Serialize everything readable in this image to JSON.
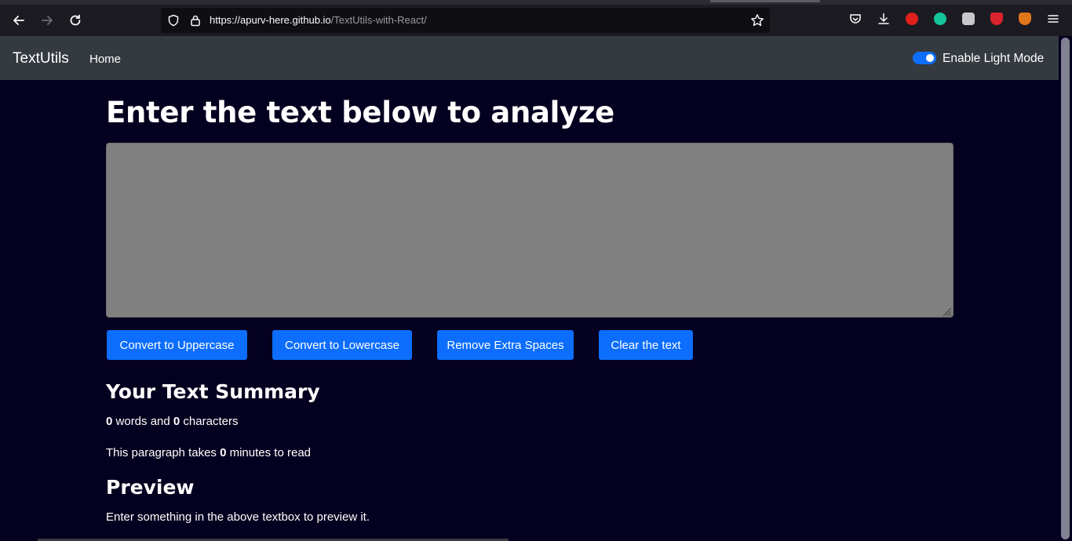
{
  "browser": {
    "url_host": "https://apurv-here.github.io",
    "url_path": "/TextUtils-with-React/",
    "icons": [
      "back-arrow-icon",
      "forward-arrow-icon",
      "reload-icon",
      "shield-icon",
      "lock-icon",
      "star-icon",
      "pocket-icon",
      "download-icon",
      "adblock-icon",
      "grammarly-icon",
      "extension-icon",
      "privacy-badger-icon",
      "metamask-icon",
      "menu-icon"
    ]
  },
  "navbar": {
    "brand": "TextUtils",
    "home": "Home",
    "toggle_label": "Enable Light Mode",
    "toggle_on": true
  },
  "main": {
    "heading": "Enter the text below to analyze",
    "textarea_value": "",
    "buttons": {
      "uppercase": "Convert to Uppercase",
      "lowercase": "Convert to Lowercase",
      "extra_spaces": "Remove Extra Spaces",
      "clear": "Clear the text"
    },
    "summary": {
      "title": "Your Text Summary",
      "words": "0",
      "words_label": "words and",
      "characters": "0",
      "characters_label": "characters",
      "read_prefix": "This paragraph takes",
      "minutes": "0",
      "read_suffix": "minutes to read"
    },
    "preview": {
      "title": "Preview",
      "text": "Enter something in the above textbox to preview it."
    }
  },
  "colors": {
    "page_bg": "#04001f",
    "navbar_bg": "#343a40",
    "accent": "#0d6efd",
    "textarea_bg": "#808080"
  }
}
